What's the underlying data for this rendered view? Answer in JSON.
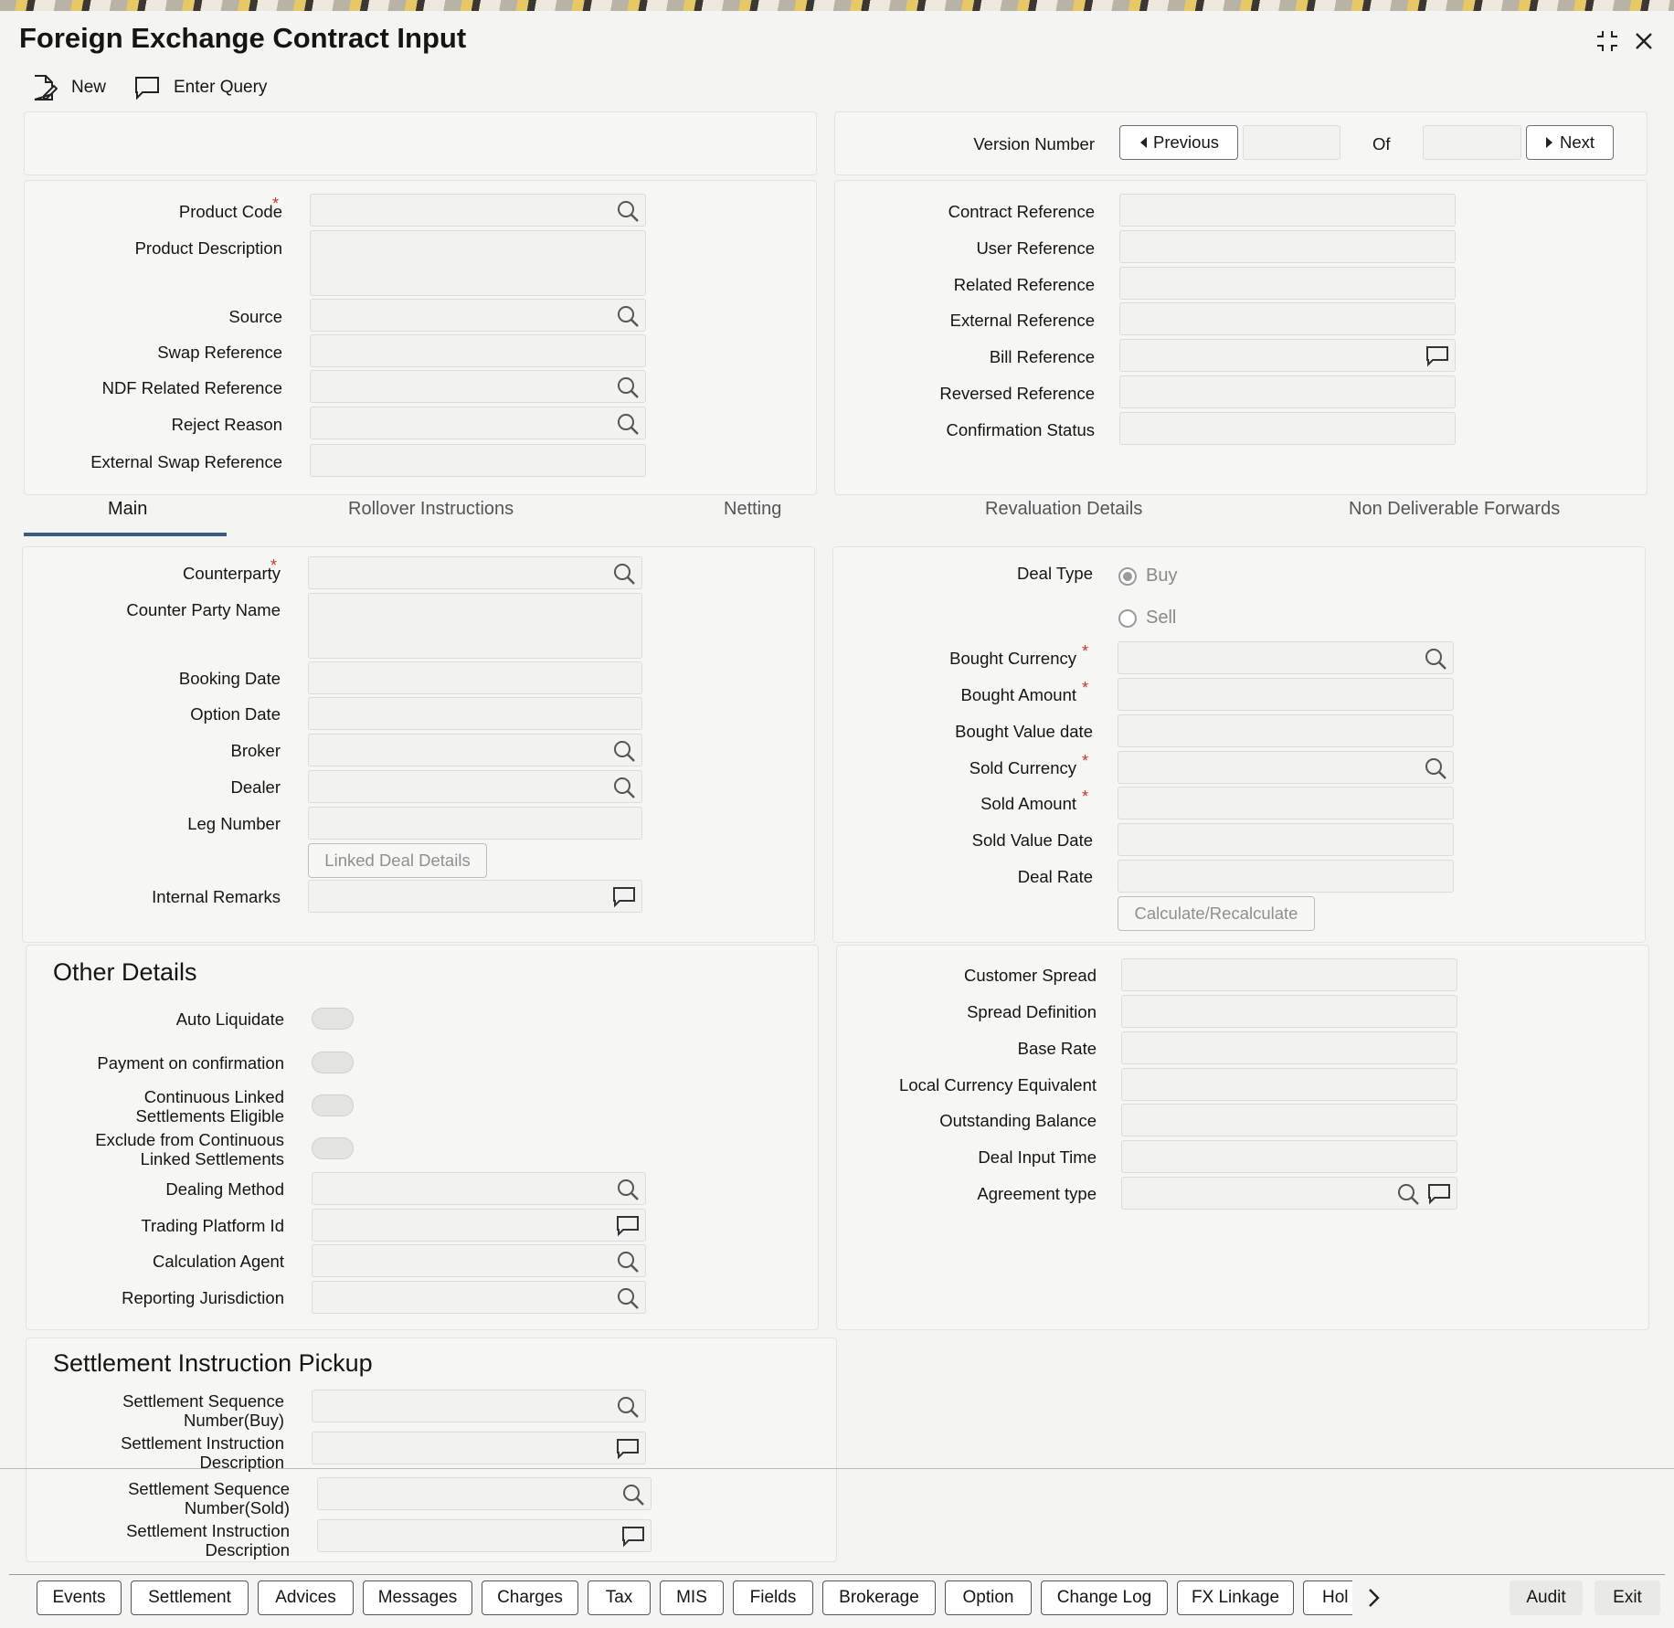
{
  "window": {
    "title": "Foreign Exchange Contract Input",
    "icons": [
      "expand-icon",
      "close-icon"
    ]
  },
  "toolbar": {
    "new_label": "New",
    "enter_query_label": "Enter Query"
  },
  "version": {
    "label": "Version Number",
    "previous_label": "Previous",
    "of_label": "Of",
    "next_label": "Next"
  },
  "header_left": {
    "product_code": "Product Code",
    "product_description": "Product Description",
    "source": "Source",
    "swap_reference": "Swap Reference",
    "ndf_related_reference": "NDF Related Reference",
    "reject_reason": "Reject Reason",
    "external_swap_reference": "External Swap Reference",
    "required_mark": "*"
  },
  "header_right": {
    "contract_reference": "Contract Reference",
    "user_reference": "User Reference",
    "related_reference": "Related Reference",
    "external_reference": "External Reference",
    "bill_reference": "Bill Reference",
    "reversed_reference": "Reversed Reference",
    "confirmation_status": "Confirmation Status"
  },
  "tabs": [
    {
      "label": "Main",
      "active": true
    },
    {
      "label": "Rollover Instructions",
      "active": false
    },
    {
      "label": "Netting",
      "active": false
    },
    {
      "label": "Revaluation Details",
      "active": false
    },
    {
      "label": "Non Deliverable Forwards",
      "active": false
    }
  ],
  "main_left": {
    "counterparty": "Counterparty",
    "counter_party_name": "Counter Party Name",
    "booking_date": "Booking Date",
    "option_date": "Option Date",
    "broker": "Broker",
    "dealer": "Dealer",
    "leg_number": "Leg Number",
    "linked_deal_details": "Linked Deal Details",
    "internal_remarks": "Internal Remarks"
  },
  "main_right": {
    "deal_type": "Deal Type",
    "buy": "Buy",
    "sell": "Sell",
    "selected_deal_type": "Buy",
    "bought_currency": "Bought Currency",
    "bought_amount": "Bought Amount",
    "bought_value_date": "Bought Value date",
    "sold_currency": "Sold Currency",
    "sold_amount": "Sold Amount",
    "sold_value_date": "Sold Value Date",
    "deal_rate": "Deal Rate",
    "calculate": "Calculate/Recalculate"
  },
  "other_details": {
    "heading": "Other Details",
    "auto_liquidate": "Auto Liquidate",
    "payment_on_confirmation": "Payment on confirmation",
    "continuous_linked_1": "Continuous Linked",
    "continuous_linked_2": "Settlements Eligible",
    "exclude_1": "Exclude from Continuous",
    "exclude_2": "Linked Settlements",
    "dealing_method": "Dealing Method",
    "trading_platform_id": "Trading Platform Id",
    "calculation_agent": "Calculation Agent",
    "reporting_jurisdiction": "Reporting Jurisdiction"
  },
  "other_right": {
    "customer_spread": "Customer Spread",
    "spread_definition": "Spread Definition",
    "base_rate": "Base Rate",
    "local_currency_equivalent": "Local Currency Equivalent",
    "outstanding_balance": "Outstanding Balance",
    "deal_input_time": "Deal Input Time",
    "agreement_type": "Agreement type"
  },
  "settlement": {
    "heading": "Settlement Instruction Pickup",
    "seq_buy_1": "Settlement Sequence",
    "seq_buy_2": "Number(Buy)",
    "desc_1": "Settlement Instruction",
    "desc_2": "Description",
    "seq_sold_1": "Settlement Sequence",
    "seq_sold_2": "Number(Sold)"
  },
  "bottom_buttons": [
    "Events",
    "Settlement",
    "Advices",
    "Messages",
    "Charges",
    "Tax",
    "MIS",
    "Fields",
    "Brokerage",
    "Option",
    "Change Log",
    "FX Linkage",
    "Hol"
  ],
  "bottom_right": {
    "audit": "Audit",
    "exit": "Exit"
  }
}
